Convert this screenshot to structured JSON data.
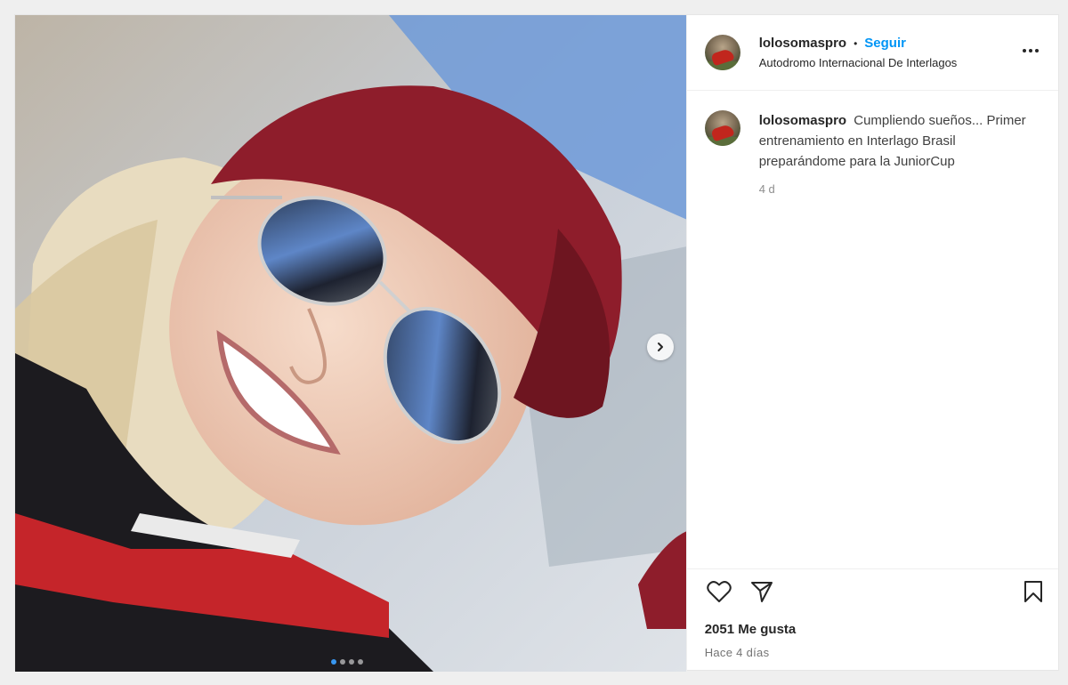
{
  "post": {
    "header": {
      "username": "lolosomaspro",
      "separator": "•",
      "follow_label": "Seguir",
      "location": "Autodromo Internacional De Interlagos"
    },
    "caption": {
      "username": "lolosomaspro",
      "text": "Cumpliendo sueños... Primer entrenamiento en Interlago Brasil preparándome para la JuniorCup",
      "age": "4 d"
    },
    "likes": "2051 Me gusta",
    "date": "Hace 4 días",
    "carousel": {
      "slides": 4,
      "active_slide": 1
    },
    "icons": {
      "like": "heart-icon",
      "share": "paper-plane-icon",
      "save": "bookmark-icon",
      "more": "more-options-icon",
      "next": "chevron-right-icon"
    },
    "colors": {
      "accent": "#0095f6",
      "carousel_active": "#3897f0",
      "cap": "#8e1d2b",
      "text": "#262626",
      "muted": "#737373"
    }
  }
}
